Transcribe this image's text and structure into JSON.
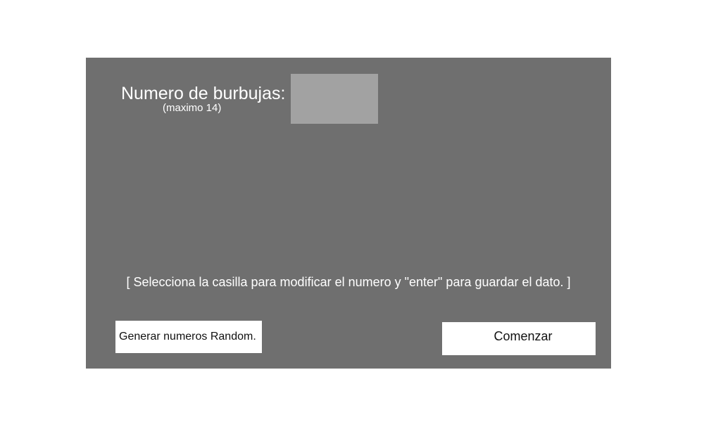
{
  "form": {
    "count_label": "Numero de burbujas:",
    "count_hint": "(maximo 14)",
    "count_value": "",
    "instructions": "[ Selecciona la casilla para modificar el numero y \"enter\" para guardar el dato. ]"
  },
  "buttons": {
    "random_label": "Generar numeros Random.",
    "start_label": "Comenzar"
  },
  "colors": {
    "panel": "#6f6f6f",
    "input": "#a2a2a2",
    "button": "#ffffff",
    "text": "#ffffff"
  }
}
